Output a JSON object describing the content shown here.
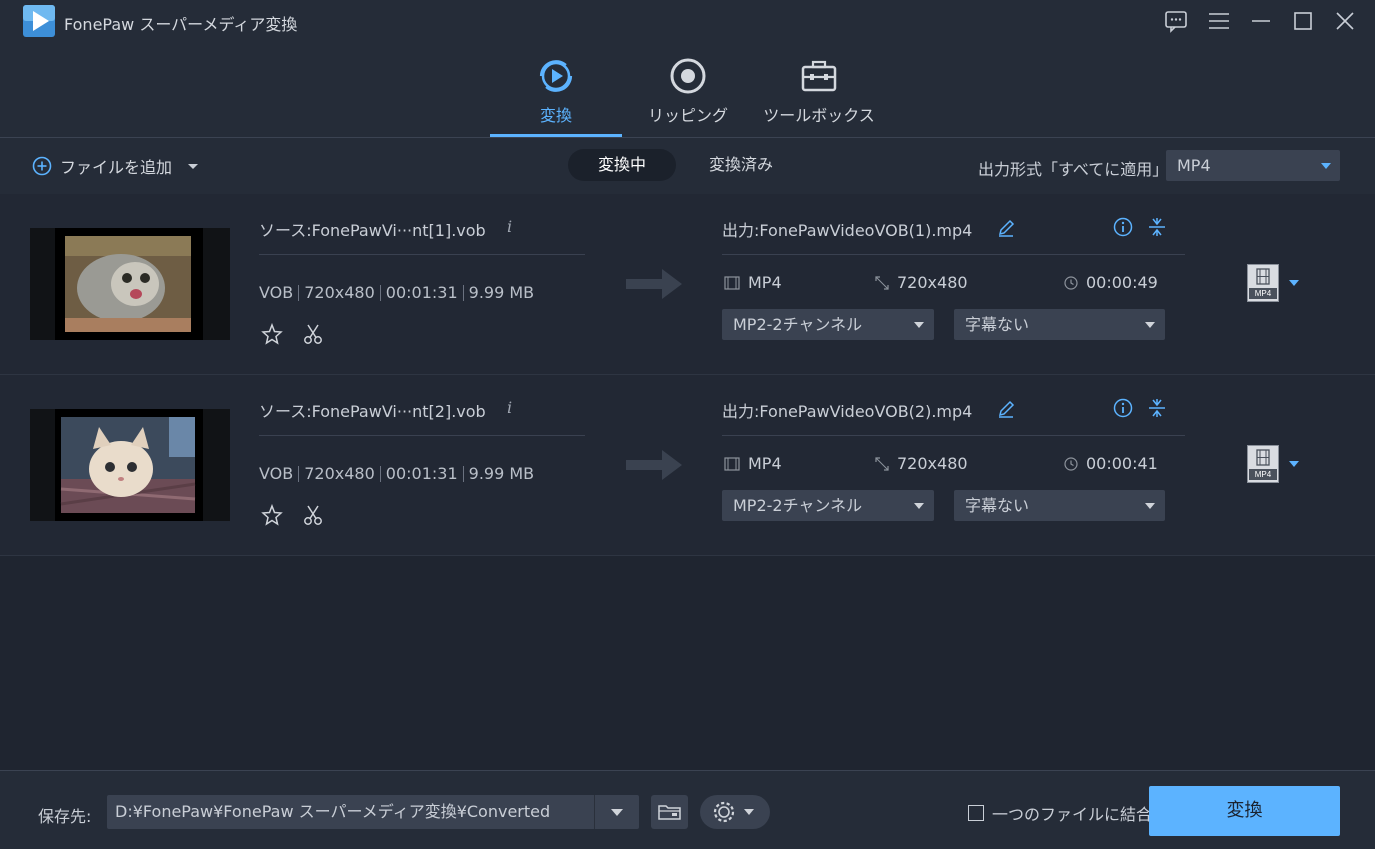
{
  "app": {
    "title": "FonePaw スーパーメディア変換"
  },
  "tabs": [
    {
      "label": "変換",
      "icon": "convert-play-icon",
      "active": true
    },
    {
      "label": "リッピング",
      "icon": "disc-icon",
      "active": false
    },
    {
      "label": "ツールボックス",
      "icon": "toolbox-icon",
      "active": false
    }
  ],
  "toolbar": {
    "add_file": "ファイルを追加",
    "seg_converting": "変換中",
    "seg_converted": "変換済み",
    "format_label": "出力形式「すべてに適用」:",
    "format_value": "MP4"
  },
  "files": [
    {
      "source": "ソース:FonePawVi···nt[1].vob",
      "meta": [
        "VOB",
        "720x480",
        "00:01:31",
        "9.99 MB"
      ],
      "output": "出力:FonePawVideoVOB(1).mp4",
      "out_format": "MP4",
      "out_resolution": "720x480",
      "out_duration": "00:00:49",
      "audio": "MP2-2チャンネル",
      "subtitle": "字幕ない",
      "badge": "MP4"
    },
    {
      "source": "ソース:FonePawVi···nt[2].vob",
      "meta": [
        "VOB",
        "720x480",
        "00:01:31",
        "9.99 MB"
      ],
      "output": "出力:FonePawVideoVOB(2).mp4",
      "out_format": "MP4",
      "out_resolution": "720x480",
      "out_duration": "00:00:41",
      "audio": "MP2-2チャンネル",
      "subtitle": "字幕ない",
      "badge": "MP4"
    }
  ],
  "footer": {
    "save_label": "保存先:",
    "save_path": "D:¥FonePaw¥FonePaw スーパーメディア変換¥Converted",
    "merge_label": "一つのファイルに結合",
    "convert_button": "変換"
  },
  "colors": {
    "accent": "#5cb3ff",
    "background": "#252c38"
  }
}
